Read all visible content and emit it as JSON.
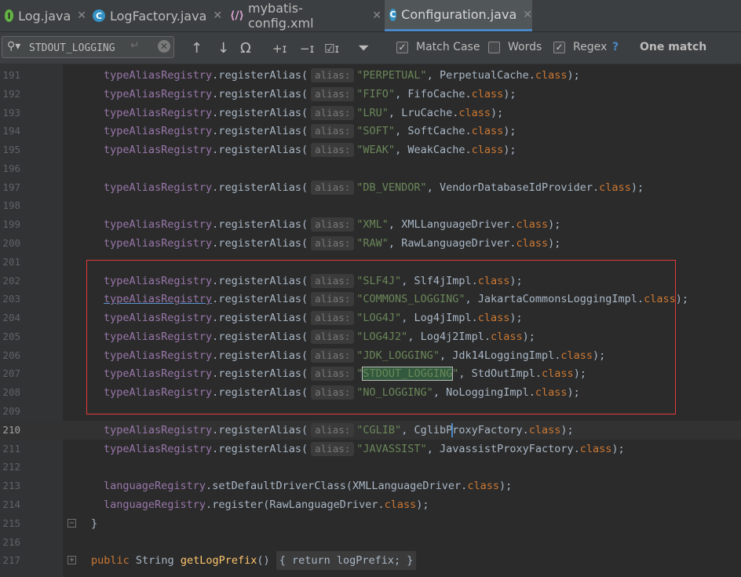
{
  "tabs": [
    {
      "label": "Log.java",
      "icon": "I"
    },
    {
      "label": "LogFactory.java",
      "icon": "C"
    },
    {
      "label": "mybatis-config.xml",
      "icon": "X"
    },
    {
      "label": "Configuration.java",
      "icon": "C"
    }
  ],
  "find": {
    "query": "STDOUT_LOGGING",
    "match_case_label": "Match Case",
    "words_label": "Words",
    "regex_label": "Regex",
    "help": "?",
    "status": "One match",
    "match_case_checked": "✓",
    "regex_checked": "✓"
  },
  "code": {
    "field": "typeAliasRegistry",
    "method": "registerAlias",
    "hint": "alias:",
    "class_kw": "class",
    "lang_field": "languageRegistry",
    "lines": [
      {
        "n": "191",
        "alias": "\"PERPETUAL\"",
        "cls": "PerpetualCache"
      },
      {
        "n": "192",
        "alias": "\"FIFO\"",
        "cls": "FifoCache"
      },
      {
        "n": "193",
        "alias": "\"LRU\"",
        "cls": "LruCache"
      },
      {
        "n": "194",
        "alias": "\"SOFT\"",
        "cls": "SoftCache"
      },
      {
        "n": "195",
        "alias": "\"WEAK\"",
        "cls": "WeakCache"
      },
      {
        "n": "196"
      },
      {
        "n": "197",
        "alias": "\"DB_VENDOR\"",
        "cls": "VendorDatabaseIdProvider"
      },
      {
        "n": "198"
      },
      {
        "n": "199",
        "alias": "\"XML\"",
        "cls": "XMLLanguageDriver"
      },
      {
        "n": "200",
        "alias": "\"RAW\"",
        "cls": "RawLanguageDriver"
      },
      {
        "n": "201"
      },
      {
        "n": "202",
        "alias": "\"SLF4J\"",
        "cls": "Slf4jImpl"
      },
      {
        "n": "203",
        "alias": "\"COMMONS_LOGGING\"",
        "cls": "JakartaCommonsLoggingImpl"
      },
      {
        "n": "204",
        "alias": "\"LOG4J\"",
        "cls": "Log4jImpl"
      },
      {
        "n": "205",
        "alias": "\"LOG4J2\"",
        "cls": "Log4j2Impl"
      },
      {
        "n": "206",
        "alias": "\"JDK_LOGGING\"",
        "cls": "Jdk14LoggingImpl"
      },
      {
        "n": "207",
        "alias_pre": "\"",
        "alias_hit": "STDOUT_LOGGING",
        "alias_post": "\"",
        "cls": "StdOutImpl"
      },
      {
        "n": "208",
        "alias": "\"NO_LOGGING\"",
        "cls": "NoLoggingImpl"
      },
      {
        "n": "209"
      },
      {
        "n": "210",
        "alias": "\"CGLIB\"",
        "cls_a": "CglibP",
        "cls_b": "roxyFactory"
      },
      {
        "n": "211",
        "alias": "\"JAVASSIST\"",
        "cls": "JavassistProxyFactory"
      },
      {
        "n": "212"
      },
      {
        "n": "213",
        "m": "setDefaultDriverClass",
        "arg": "XMLLanguageDriver"
      },
      {
        "n": "214",
        "m": "register",
        "arg": "RawLanguageDriver"
      },
      {
        "n": "215",
        "text": "}"
      },
      {
        "n": "216"
      },
      {
        "n": "217",
        "kw": "public",
        "type": "String",
        "m": "getLogPrefix",
        "folded": "{ return logPrefix; }"
      }
    ]
  }
}
